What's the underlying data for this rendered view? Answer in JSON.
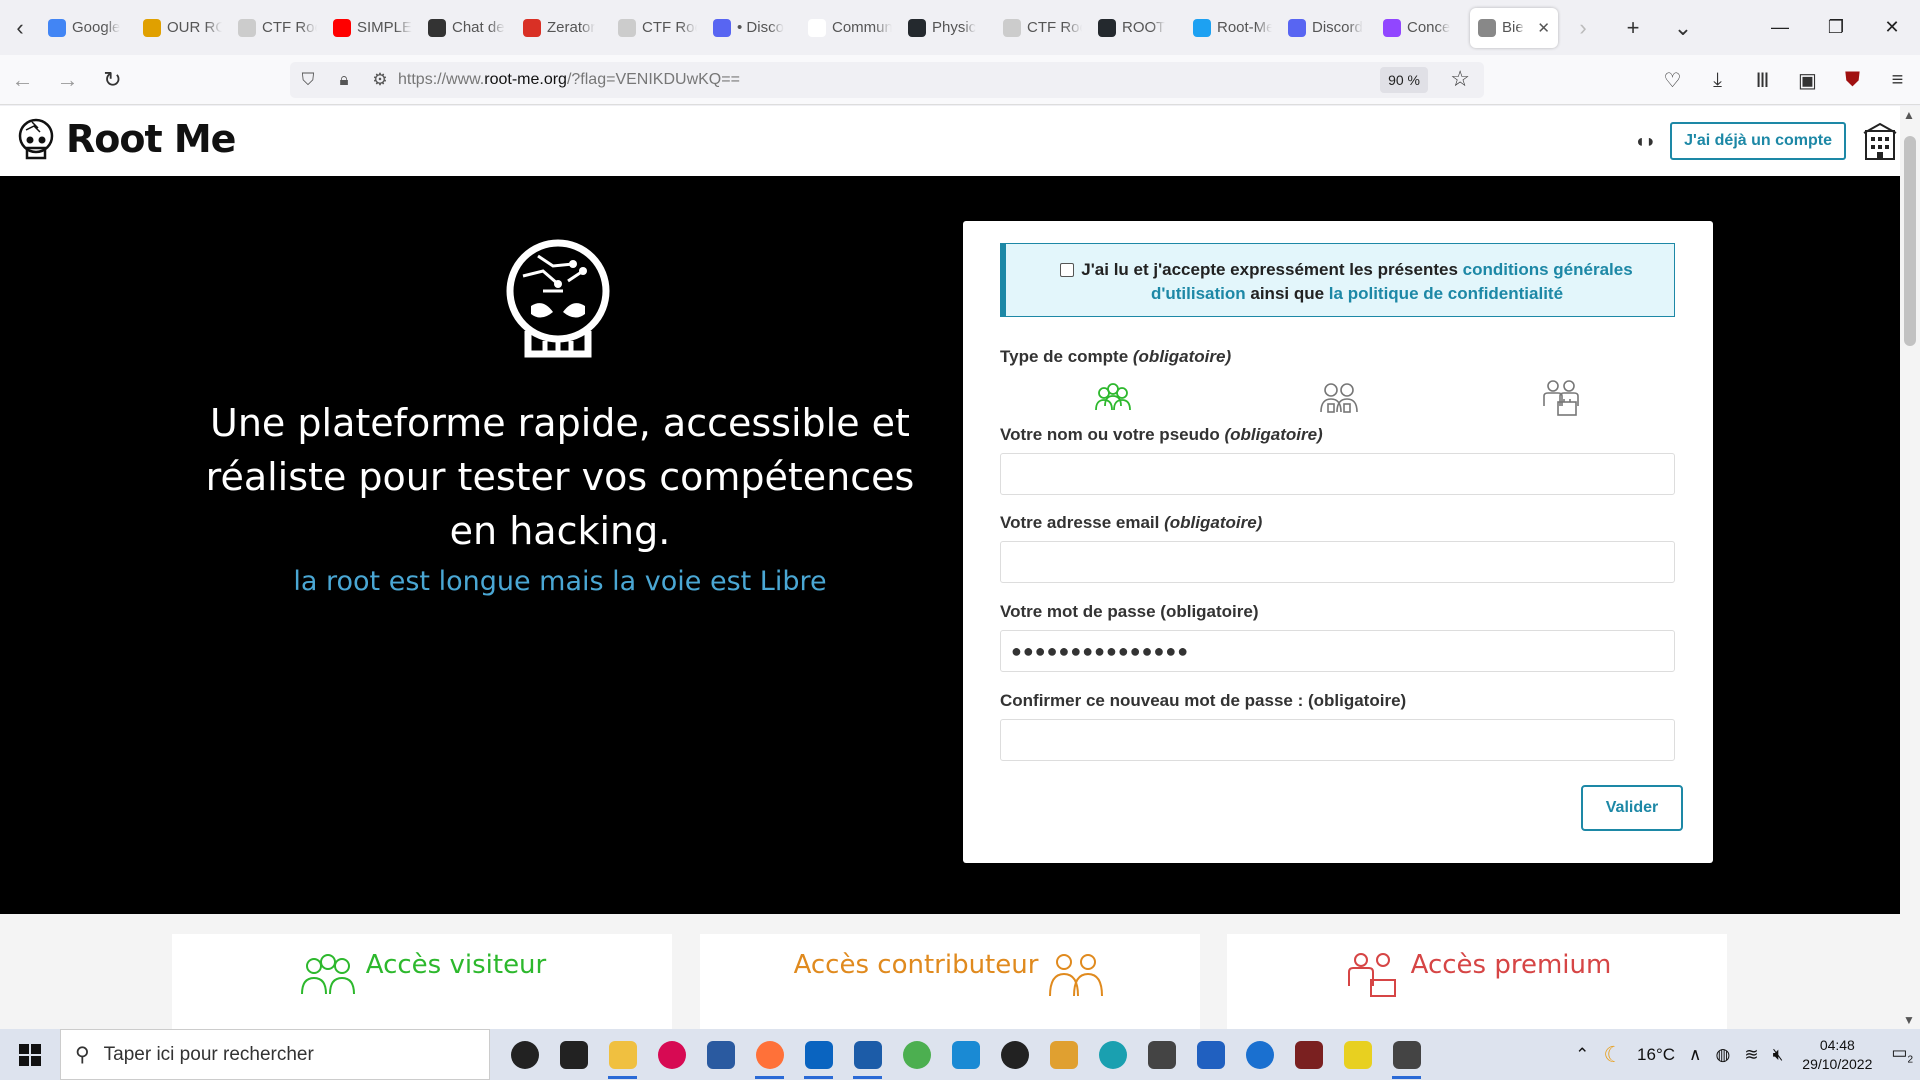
{
  "browser": {
    "tabs": [
      {
        "label": "Google",
        "color": "#4285f4"
      },
      {
        "label": "OUR RO",
        "color": "#e0a000"
      },
      {
        "label": "CTF Root",
        "color": "#cccccc"
      },
      {
        "label": "SIMPLE",
        "color": "#ff0000"
      },
      {
        "label": "Chat de",
        "color": "#333333"
      },
      {
        "label": "Zerator",
        "color": "#d93025"
      },
      {
        "label": "CTF Root",
        "color": "#cccccc"
      },
      {
        "label": "• Disco",
        "color": "#5865f2"
      },
      {
        "label": "Communit",
        "color": "#ffffff"
      },
      {
        "label": "Physic",
        "color": "#24292e"
      },
      {
        "label": "CTF Root",
        "color": "#cccccc"
      },
      {
        "label": "ROOT",
        "color": "#24292e"
      },
      {
        "label": "Root-Me",
        "color": "#1da1f2"
      },
      {
        "label": "Discord",
        "color": "#5865f2"
      },
      {
        "label": "Conce",
        "color": "#9146ff"
      },
      {
        "label": "Bie",
        "color": "#888888",
        "active": true
      }
    ],
    "url_prefix": "https://www.",
    "url_host": "root-me.org",
    "url_path": "/?flag=VENIKDUwKQ==",
    "zoom": "90 %"
  },
  "site": {
    "logo_text": "Root Me",
    "login_button": "J'ai déjà un compte"
  },
  "hero": {
    "title": "Une plateforme rapide, accessible et réaliste pour tester vos compétences en hacking.",
    "subtitle": "la root est longue mais la voie est Libre"
  },
  "form": {
    "terms_prefix": "J'ai lu et j'accepte expressément les présentes ",
    "terms_link1": "conditions générales d'utilisation",
    "terms_middle": " ainsi que ",
    "terms_link2": "la politique de confidentialité",
    "account_type_label": "Type de compte ",
    "required": "(obligatoire)",
    "name_label": "Votre nom ou votre pseudo ",
    "email_label": "Votre adresse email ",
    "password_label": "Votre mot de passe (obligatoire)",
    "password_value": "●●●●●●●●●●●●●●●",
    "confirm_label": "Confirmer ce nouveau mot de passe : (obligatoire)",
    "submit": "Valider"
  },
  "access": [
    {
      "label": "Accès visiteur",
      "color": "#2db82d"
    },
    {
      "label": "Accès contributeur",
      "color": "#e08a1e"
    },
    {
      "label": "Accès premium",
      "color": "#d64545"
    }
  ],
  "taskbar": {
    "search_placeholder": "Taper ici pour rechercher",
    "temperature": "16°C",
    "time": "04:48",
    "date": "29/10/2022",
    "notification_count": "2"
  }
}
